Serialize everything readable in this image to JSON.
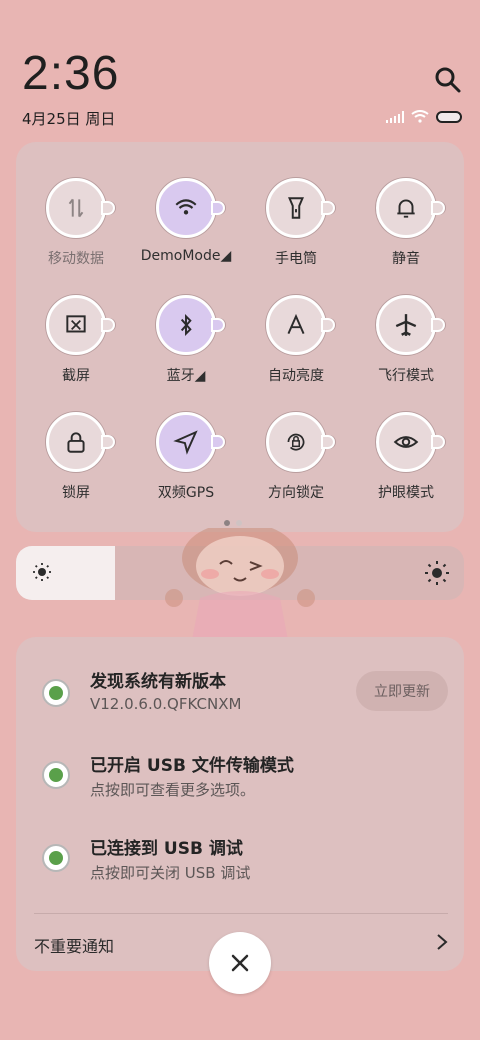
{
  "header": {
    "time": "2:36",
    "date": "4月25日 周日"
  },
  "quick_settings": {
    "tiles": [
      {
        "label": "移动数据",
        "icon": "mobile-data-icon",
        "active": false,
        "muted": true
      },
      {
        "label": "DemoMode◢",
        "icon": "wifi-icon",
        "active": true,
        "muted": false
      },
      {
        "label": "手电筒",
        "icon": "flashlight-icon",
        "active": false,
        "muted": false
      },
      {
        "label": "静音",
        "icon": "bell-icon",
        "active": false,
        "muted": false
      },
      {
        "label": "截屏",
        "icon": "screenshot-icon",
        "active": false,
        "muted": false
      },
      {
        "label": "蓝牙◢",
        "icon": "bluetooth-icon",
        "active": true,
        "muted": false
      },
      {
        "label": "自动亮度",
        "icon": "auto-brightness-icon",
        "active": false,
        "muted": false
      },
      {
        "label": "飞行模式",
        "icon": "airplane-icon",
        "active": false,
        "muted": false
      },
      {
        "label": "锁屏",
        "icon": "lock-icon",
        "active": false,
        "muted": false
      },
      {
        "label": "双频GPS",
        "icon": "gps-icon",
        "active": true,
        "muted": false
      },
      {
        "label": "方向锁定",
        "icon": "rotation-lock-icon",
        "active": false,
        "muted": false
      },
      {
        "label": "护眼模式",
        "icon": "eye-icon",
        "active": false,
        "muted": false
      }
    ],
    "page_count": 2,
    "current_page": 1
  },
  "brightness": {
    "level": 0.22
  },
  "notifications": {
    "items": [
      {
        "title": "发现系统有新版本",
        "subtitle": "V12.0.6.0.QFKCNXM"
      },
      {
        "title": "已开启 USB 文件传输模式",
        "subtitle": "点按即可查看更多选项。"
      },
      {
        "title": "已连接到 USB 调试",
        "subtitle": "点按即可关闭 USB 调试"
      }
    ],
    "update_button": "立即更新",
    "unimportant_label": "不重要通知"
  },
  "colors": {
    "background": "#e8b5b3",
    "panel": "#ddc0c0",
    "active_tile": "#d9c9ef"
  }
}
